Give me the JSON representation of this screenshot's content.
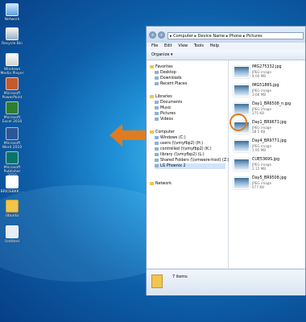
{
  "desktop": {
    "icons": [
      {
        "label": "Network",
        "icon": "network-icon"
      },
      {
        "label": "Recycle Bin",
        "icon": "recycle-bin-icon"
      },
      {
        "label": "Windows Media Player",
        "icon": "media-player-icon"
      },
      {
        "label": "Microsoft PowerPoint ...",
        "icon": "powerpoint-icon"
      },
      {
        "label": "Microsoft Excel 2010",
        "icon": "excel-icon"
      },
      {
        "label": "Microsoft Word 2010",
        "icon": "word-icon"
      },
      {
        "label": "Microsoft Publisher 2010",
        "icon": "publisher-icon"
      },
      {
        "label": "BRIOSBKK ...",
        "icon": "text-file-icon"
      },
      {
        "label": "Ubuntu",
        "icon": "folder-icon"
      },
      {
        "label": "Untitled",
        "icon": "document-icon"
      }
    ]
  },
  "explorer": {
    "breadcrumb": "▸ Computer ▸ Device Name ▸ Phone ▸ Pictures",
    "menu": [
      "File",
      "Edit",
      "View",
      "Tools",
      "Help"
    ],
    "organize_label": "Organize ▾",
    "nav": [
      {
        "label": "Favorites",
        "type": "group"
      },
      {
        "label": "Desktop",
        "type": "item"
      },
      {
        "label": "Downloads",
        "type": "item"
      },
      {
        "label": "Recent Places",
        "type": "item"
      },
      {
        "label": "Libraries",
        "type": "group"
      },
      {
        "label": "Documents",
        "type": "item"
      },
      {
        "label": "Music",
        "type": "item"
      },
      {
        "label": "Pictures",
        "type": "item"
      },
      {
        "label": "Videos",
        "type": "item"
      },
      {
        "label": "Computer",
        "type": "group"
      },
      {
        "label": "Windows (C:)",
        "type": "item"
      },
      {
        "label": "users (\\\\vmyfbp2) (H:)",
        "type": "item"
      },
      {
        "label": "controlled (\\\\vmyfbp2) (K:)",
        "type": "item"
      },
      {
        "label": "library (\\\\vmyfbp2) (L:)",
        "type": "item"
      },
      {
        "label": "Shared Folders (\\\\vmware-host) (Z:)",
        "type": "item"
      },
      {
        "label": "LG Phoenix 2",
        "type": "item",
        "selected": true
      },
      {
        "label": "Network",
        "type": "group"
      }
    ],
    "files": [
      {
        "name": "IMG275332.jpg",
        "type": "JPEG image",
        "size": "4.00 MB"
      },
      {
        "name": "IMG5188S.jpg",
        "type": "JPEG image",
        "size": "3.68 MB"
      },
      {
        "name": "Day1_BR6508_n.jpg",
        "type": "JPEG image",
        "size": "275 KB"
      },
      {
        "name": "Day1_BR9671.jpg",
        "type": "JPEG image",
        "size": "28.5 KB"
      },
      {
        "name": "Day4_BR9771.jpg",
        "type": "JPEG image",
        "size": "1.95 MB"
      },
      {
        "name": "CUE5369S.jpg",
        "type": "JPEG image",
        "size": "2.15 MB"
      },
      {
        "name": "Day5_BR9508.jpg",
        "type": "JPEG image",
        "size": "677 KB"
      }
    ],
    "item_count": "7 items"
  },
  "colors": {
    "highlight": "#e07b20"
  }
}
